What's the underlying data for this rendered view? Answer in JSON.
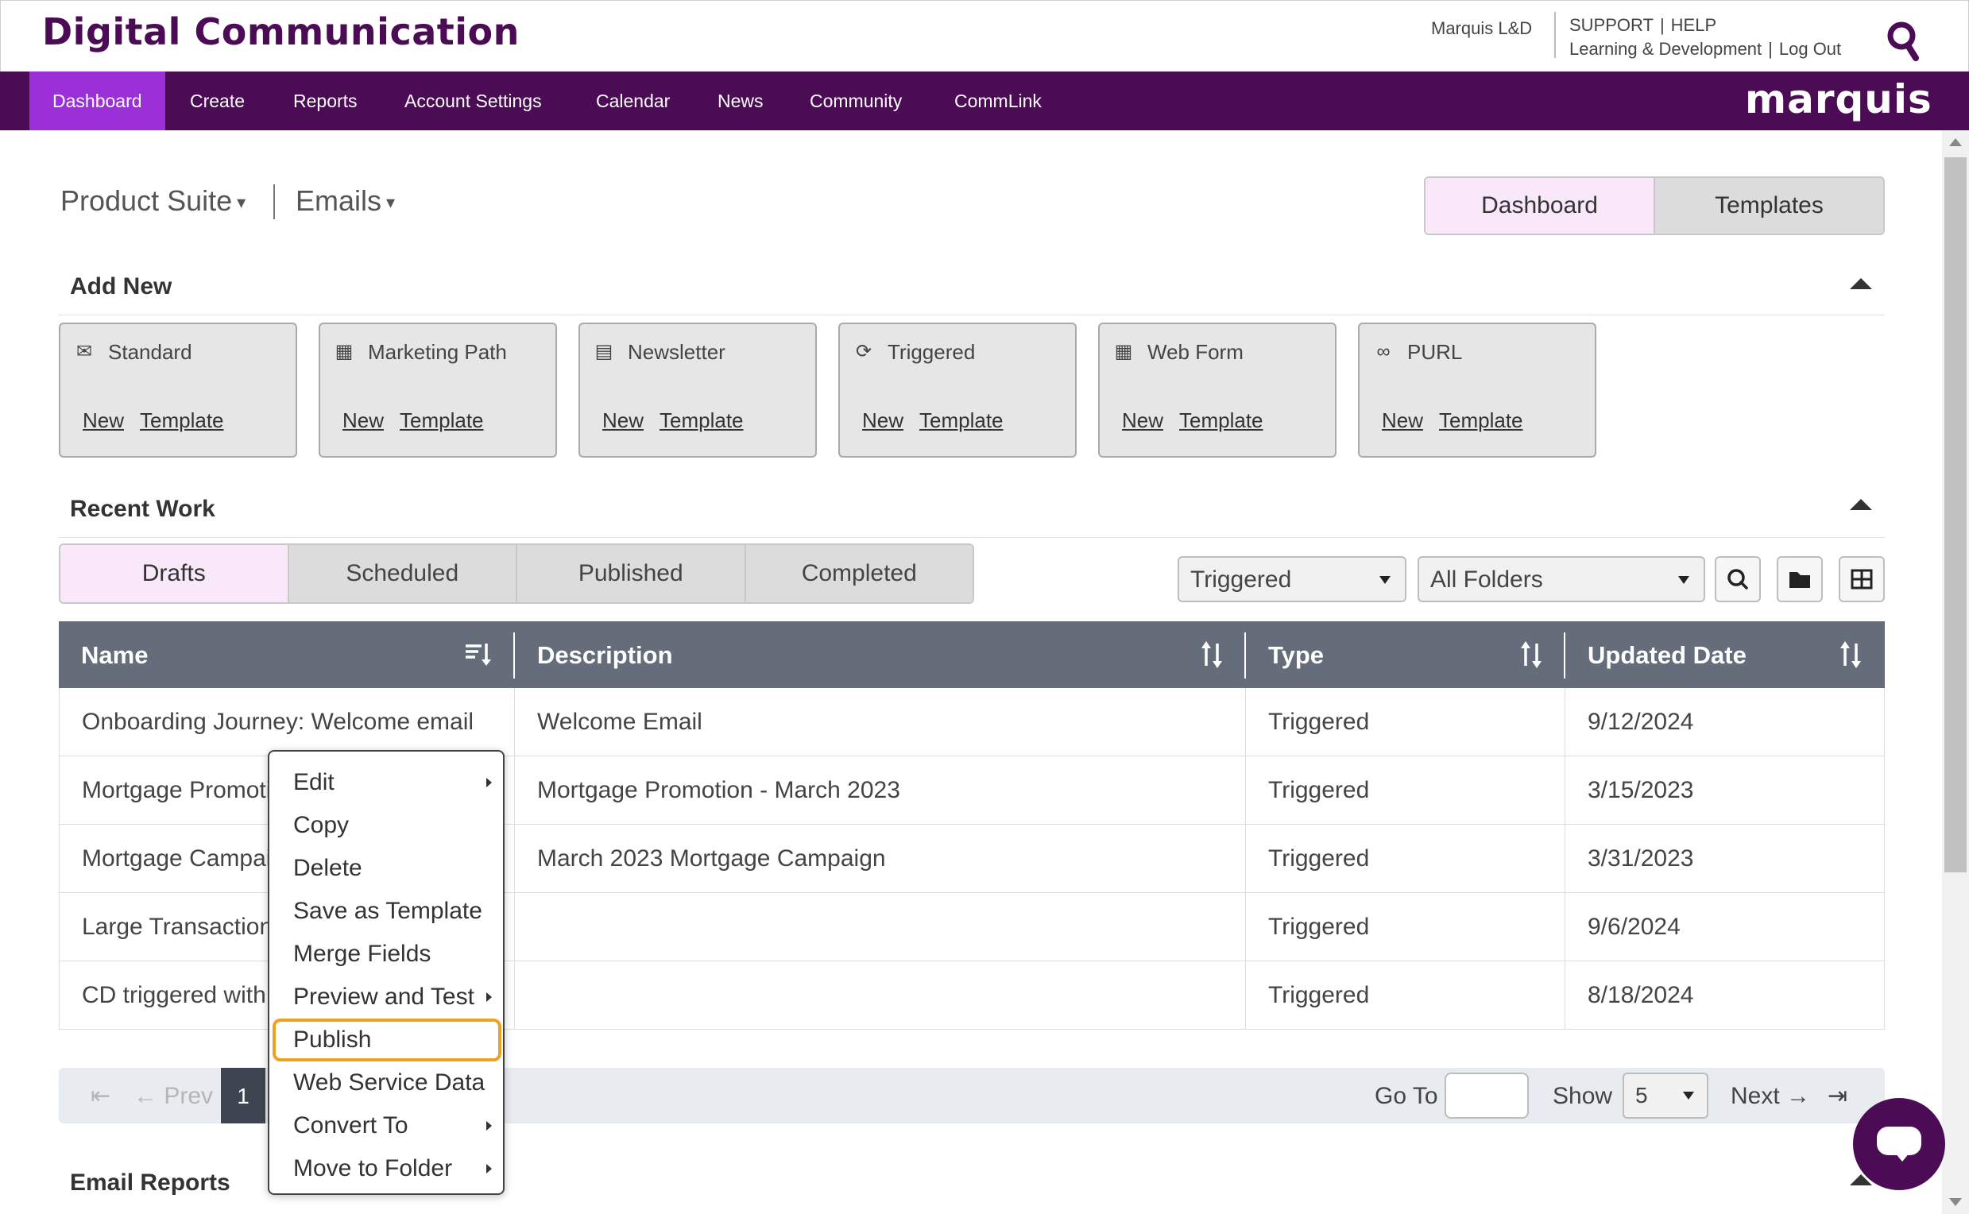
{
  "header": {
    "app_title": "Digital Communication",
    "org_name": "Marquis L&D",
    "links_row1": [
      "SUPPORT",
      "HELP"
    ],
    "links_row2": [
      "Learning & Development",
      "Log Out"
    ],
    "separator": "|"
  },
  "nav": {
    "items": [
      "Dashboard",
      "Create",
      "Reports",
      "Account Settings",
      "Calendar",
      "News",
      "Community",
      "CommLink"
    ],
    "active": "Dashboard",
    "brand": "marquis",
    "color": "#4b0b55",
    "active_color": "#9b30d9"
  },
  "breadcrumb": {
    "product": "Product Suite",
    "section": "Emails",
    "caret": "▾"
  },
  "view_toggle": {
    "options": [
      "Dashboard",
      "Templates"
    ],
    "active": "Dashboard"
  },
  "add_new": {
    "title": "Add New",
    "cards": [
      {
        "label": "Standard",
        "icon": "envelope-icon",
        "glyph": "✉",
        "links": [
          "New",
          "Template"
        ]
      },
      {
        "label": "Marketing Path",
        "icon": "calendar-icon",
        "glyph": "▦",
        "links": [
          "New",
          "Template"
        ]
      },
      {
        "label": "Newsletter",
        "icon": "newspaper-icon",
        "glyph": "▤",
        "links": [
          "New",
          "Template"
        ]
      },
      {
        "label": "Triggered",
        "icon": "refresh-icon",
        "glyph": "⟳",
        "links": [
          "New",
          "Template"
        ]
      },
      {
        "label": "Web Form",
        "icon": "table-icon",
        "glyph": "▦",
        "links": [
          "New",
          "Template"
        ]
      },
      {
        "label": "PURL",
        "icon": "link-icon",
        "glyph": "∞",
        "links": [
          "New",
          "Template"
        ]
      }
    ]
  },
  "recent_work": {
    "title": "Recent Work",
    "tabs": [
      "Drafts",
      "Scheduled",
      "Published",
      "Completed"
    ],
    "active_tab": "Drafts",
    "type_filter": "Triggered",
    "folder_filter": "All Folders"
  },
  "table": {
    "columns": [
      "Name",
      "Description",
      "Type",
      "Updated Date"
    ],
    "rows": [
      {
        "name": "Onboarding Journey: Welcome email",
        "description": "Welcome Email",
        "type": "Triggered",
        "updated": "9/12/2024"
      },
      {
        "name": "Mortgage Promotion",
        "description": "Mortgage Promotion - March 2023",
        "type": "Triggered",
        "updated": "3/15/2023"
      },
      {
        "name": "Mortgage Campaign",
        "description": "March 2023 Mortgage Campaign",
        "type": "Triggered",
        "updated": "3/31/2023"
      },
      {
        "name": "Large Transaction",
        "description": "",
        "type": "Triggered",
        "updated": "9/6/2024"
      },
      {
        "name": "CD triggered with",
        "description": "",
        "type": "Triggered",
        "updated": "8/18/2024"
      }
    ]
  },
  "pager": {
    "first": "⇤",
    "prev": "Prev",
    "current_page": "1",
    "goto_label": "Go To",
    "show_label": "Show",
    "show_value": "5",
    "next": "Next",
    "last": "⇥"
  },
  "context_menu": {
    "items": [
      {
        "label": "Edit",
        "submenu": true
      },
      {
        "label": "Copy",
        "submenu": false
      },
      {
        "label": "Delete",
        "submenu": false
      },
      {
        "label": "Save as Template",
        "submenu": false
      },
      {
        "label": "Merge Fields",
        "submenu": false
      },
      {
        "label": "Preview and Test",
        "submenu": true
      },
      {
        "label": "Publish",
        "submenu": false,
        "highlight": true
      },
      {
        "label": "Web Service Data",
        "submenu": false
      },
      {
        "label": "Convert To",
        "submenu": true
      },
      {
        "label": "Move to Folder",
        "submenu": true
      }
    ],
    "highlight_color": "#f0a020"
  },
  "email_reports": {
    "title": "Email Reports"
  }
}
